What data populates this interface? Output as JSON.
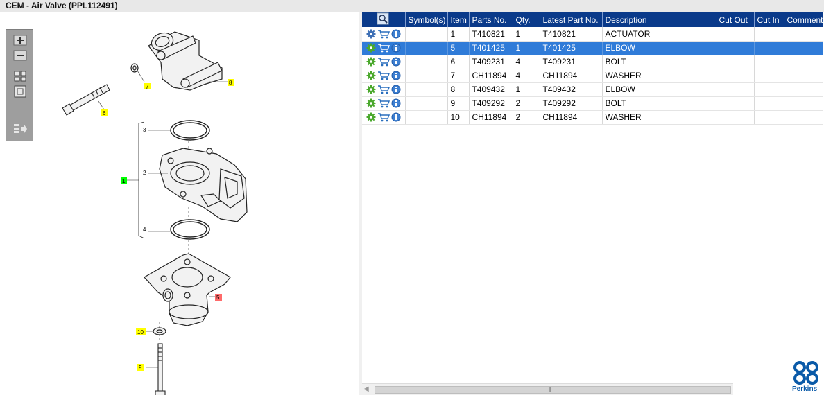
{
  "window": {
    "title": "CEM - Air Valve (PPL112491)"
  },
  "toolbox": {
    "tools": [
      {
        "name": "zoom-in-icon"
      },
      {
        "name": "zoom-out-icon"
      },
      {
        "name": "fit-all-icon"
      },
      {
        "name": "fit-window-icon"
      },
      {
        "name": "list-export-icon"
      }
    ]
  },
  "diagram": {
    "callouts": [
      "7",
      "6",
      "8",
      "3",
      "1",
      "2",
      "4",
      "5",
      "10",
      "9"
    ],
    "callout_colors": {
      "normal": "#ffff00",
      "selected": "#ff6b6b",
      "assembly": "#00ff00"
    }
  },
  "grid": {
    "headers": [
      "",
      "Symbol(s)",
      "Item",
      "Parts No.",
      "Qty.",
      "Latest Part No.",
      "Description",
      "Cut Out",
      "Cut In",
      "Comment"
    ],
    "rows": [
      {
        "item": "1",
        "parts_no": "T410821",
        "qty": "1",
        "latest": "T410821",
        "description": "ACTUATOR",
        "icon": "assembly-gear-icon",
        "selected": false
      },
      {
        "item": "5",
        "parts_no": "T401425",
        "qty": "1",
        "latest": "T401425",
        "description": "ELBOW",
        "icon": "part-gear-icon",
        "selected": true
      },
      {
        "item": "6",
        "parts_no": "T409231",
        "qty": "4",
        "latest": "T409231",
        "description": "BOLT",
        "icon": "part-gear-icon",
        "selected": false
      },
      {
        "item": "7",
        "parts_no": "CH11894",
        "qty": "4",
        "latest": "CH11894",
        "description": "WASHER",
        "icon": "part-gear-icon",
        "selected": false
      },
      {
        "item": "8",
        "parts_no": "T409432",
        "qty": "1",
        "latest": "T409432",
        "description": "ELBOW",
        "icon": "part-gear-icon",
        "selected": false
      },
      {
        "item": "9",
        "parts_no": "T409292",
        "qty": "2",
        "latest": "T409292",
        "description": "BOLT",
        "icon": "part-gear-icon",
        "selected": false
      },
      {
        "item": "10",
        "parts_no": "CH11894",
        "qty": "2",
        "latest": "CH11894",
        "description": "WASHER",
        "icon": "part-gear-icon",
        "selected": false
      }
    ]
  },
  "brand": {
    "name": "Perkins",
    "color": "#0a5aa8"
  },
  "colors": {
    "header_bg": "#0a3a8a",
    "selected_row": "#2f7bd8"
  }
}
